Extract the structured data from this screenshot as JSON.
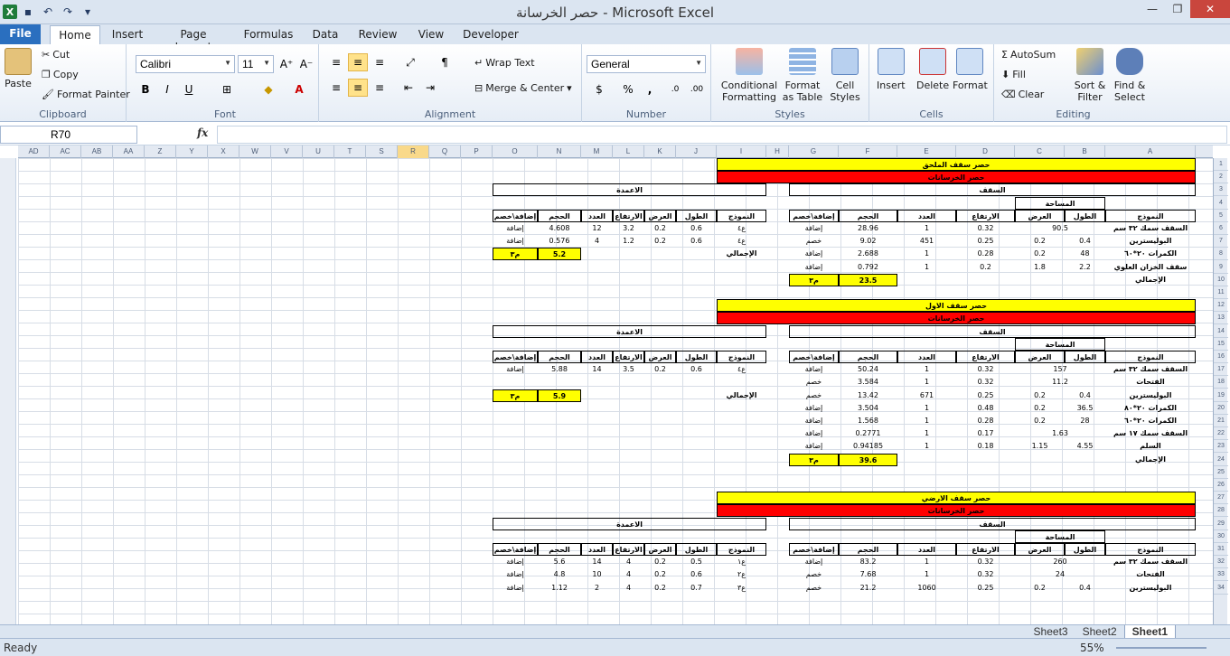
{
  "window": {
    "title": "حصر الخرسانة - Microsoft Excel"
  },
  "tabs": [
    "File",
    "Home",
    "Insert",
    "Page Layout",
    "Formulas",
    "Data",
    "Review",
    "View",
    "Developer"
  ],
  "clipboard": {
    "paste": "Paste",
    "cut": "Cut",
    "copy": "Copy",
    "format_painter": "Format Painter",
    "label": "Clipboard"
  },
  "font": {
    "name": "Calibri",
    "size": "11",
    "label": "Font"
  },
  "alignment": {
    "wrap": "Wrap Text",
    "merge": "Merge & Center",
    "label": "Alignment"
  },
  "number": {
    "format": "General",
    "label": "Number"
  },
  "styles": {
    "conditional": "Conditional Formatting",
    "format_table": "Format as Table",
    "cell_styles": "Cell Styles",
    "label": "Styles"
  },
  "cells": {
    "insert": "Insert",
    "delete": "Delete",
    "format": "Format",
    "label": "Cells"
  },
  "editing": {
    "autosum": "AutoSum",
    "fill": "Fill",
    "clear": "Clear",
    "sort": "Sort & Filter",
    "find": "Find & Select",
    "label": "Editing"
  },
  "formula_bar": {
    "name_box": "R70",
    "fx": "fx",
    "value": ""
  },
  "columns": [
    "AD",
    "AC",
    "AB",
    "AA",
    "Z",
    "Y",
    "X",
    "W",
    "V",
    "U",
    "T",
    "S",
    "R",
    "Q",
    "P",
    "O",
    "N",
    "M",
    "L",
    "K",
    "J",
    "I",
    "H",
    "G",
    "F",
    "E",
    "D",
    "C",
    "B",
    "A"
  ],
  "rows": [
    "1",
    "2",
    "3",
    "4",
    "5",
    "6",
    "7",
    "8",
    "9",
    "10",
    "11",
    "12",
    "13",
    "14",
    "15",
    "16",
    "17",
    "18",
    "19",
    "20",
    "21",
    "22",
    "23",
    "24",
    "25",
    "26",
    "27",
    "28",
    "29",
    "30",
    "31",
    "32",
    "33",
    "34"
  ],
  "sections": [
    {
      "title": "حصر سقف الملحق",
      "subtitle": "حصر الخرسانات",
      "col_group": "الاعمدة",
      "slab_group": "السقف",
      "area": "المساحة",
      "slab_headers": [
        "النموذج",
        "الطول",
        "العرض",
        "الارتفاع",
        "العدد",
        "الحجم",
        "إضافة\\خصم"
      ],
      "slab_rows": [
        [
          "السقف سمك ٣٢ سم",
          "90.5",
          "",
          "0.32",
          "1",
          "28.96",
          "إضافة"
        ],
        [
          "البوليسترين",
          "0.4",
          "0.2",
          "0.25",
          "451",
          "9.02",
          "خصم"
        ],
        [
          "الكمرات ٢٠*٦٠",
          "48",
          "0.2",
          "0.28",
          "1",
          "2.688",
          "إضافة"
        ],
        [
          "سقف الخزان العلوي",
          "2.2",
          "1.8",
          "0.2",
          "1",
          "0.792",
          "إضافة"
        ]
      ],
      "slab_total_label": "الإجمالي",
      "slab_total": "23.5",
      "unit": "م٣",
      "col_headers": [
        "النموذج",
        "الطول",
        "العرض",
        "الارتفاع",
        "العدد",
        "الحجم",
        "إضافة\\خصم"
      ],
      "col_rows": [
        [
          "ع٤",
          "0.6",
          "0.2",
          "3.2",
          "12",
          "4.608",
          "إضافة"
        ],
        [
          "ع٤",
          "0.6",
          "0.2",
          "1.2",
          "4",
          "0.576",
          "إضافة"
        ]
      ],
      "col_total_label": "الإجمالي",
      "col_total": "5.2"
    },
    {
      "title": "حصر سقف الاول",
      "subtitle": "حصر الخرسانات",
      "col_group": "الاعمدة",
      "slab_group": "السقف",
      "area": "المساحة",
      "slab_rows": [
        [
          "السقف سمك ٣٢ سم",
          "157",
          "",
          "0.32",
          "1",
          "50.24",
          "إضافة"
        ],
        [
          "الفتحات",
          "11.2",
          "",
          "0.32",
          "1",
          "3.584",
          "خصم"
        ],
        [
          "البوليسترين",
          "0.4",
          "0.2",
          "0.25",
          "671",
          "13.42",
          "خصم"
        ],
        [
          "الكمرات ٢٠*٨٠",
          "36.5",
          "0.2",
          "0.48",
          "1",
          "3.504",
          "إضافة"
        ],
        [
          "الكمرات ٢٠*٦٠",
          "28",
          "0.2",
          "0.28",
          "1",
          "1.568",
          "إضافة"
        ],
        [
          "السقف سمك ١٧ سم",
          "1.63",
          "",
          "0.17",
          "1",
          "0.2771",
          "إضافة"
        ],
        [
          "السلم",
          "4.55",
          "1.15",
          "0.18",
          "1",
          "0.94185",
          "إضافة"
        ]
      ],
      "slab_total_label": "الإجمالي",
      "slab_total": "39.6",
      "unit": "م٣",
      "col_rows": [
        [
          "ع٤",
          "0.6",
          "0.2",
          "3.5",
          "14",
          "5.88",
          "إضافة"
        ]
      ],
      "col_total_label": "الإجمالي",
      "col_total": "5.9"
    },
    {
      "title": "حصر سقف الارضي",
      "subtitle": "حصر الخرسانات",
      "col_group": "الاعمدة",
      "slab_group": "السقف",
      "area": "المساحة",
      "slab_rows": [
        [
          "السقف سمك ٣٢ سم",
          "260",
          "",
          "0.32",
          "1",
          "83.2",
          "إضافة"
        ],
        [
          "الفتحات",
          "24",
          "",
          "0.32",
          "1",
          "7.68",
          "خصم"
        ],
        [
          "البوليسترين",
          "0.4",
          "0.2",
          "0.25",
          "1060",
          "21.2",
          "خصم"
        ]
      ],
      "col_rows": [
        [
          "ع١",
          "0.5",
          "0.2",
          "4",
          "14",
          "5.6",
          "إضافة"
        ],
        [
          "ع٢",
          "0.6",
          "0.2",
          "4",
          "10",
          "4.8",
          "إضافة"
        ],
        [
          "ع٣",
          "0.7",
          "0.2",
          "4",
          "2",
          "1.12",
          "إضافة"
        ]
      ]
    }
  ],
  "sheet_tabs": [
    "Sheet3",
    "Sheet2",
    "Sheet1"
  ],
  "status": {
    "ready": "Ready",
    "zoom": "55%"
  }
}
